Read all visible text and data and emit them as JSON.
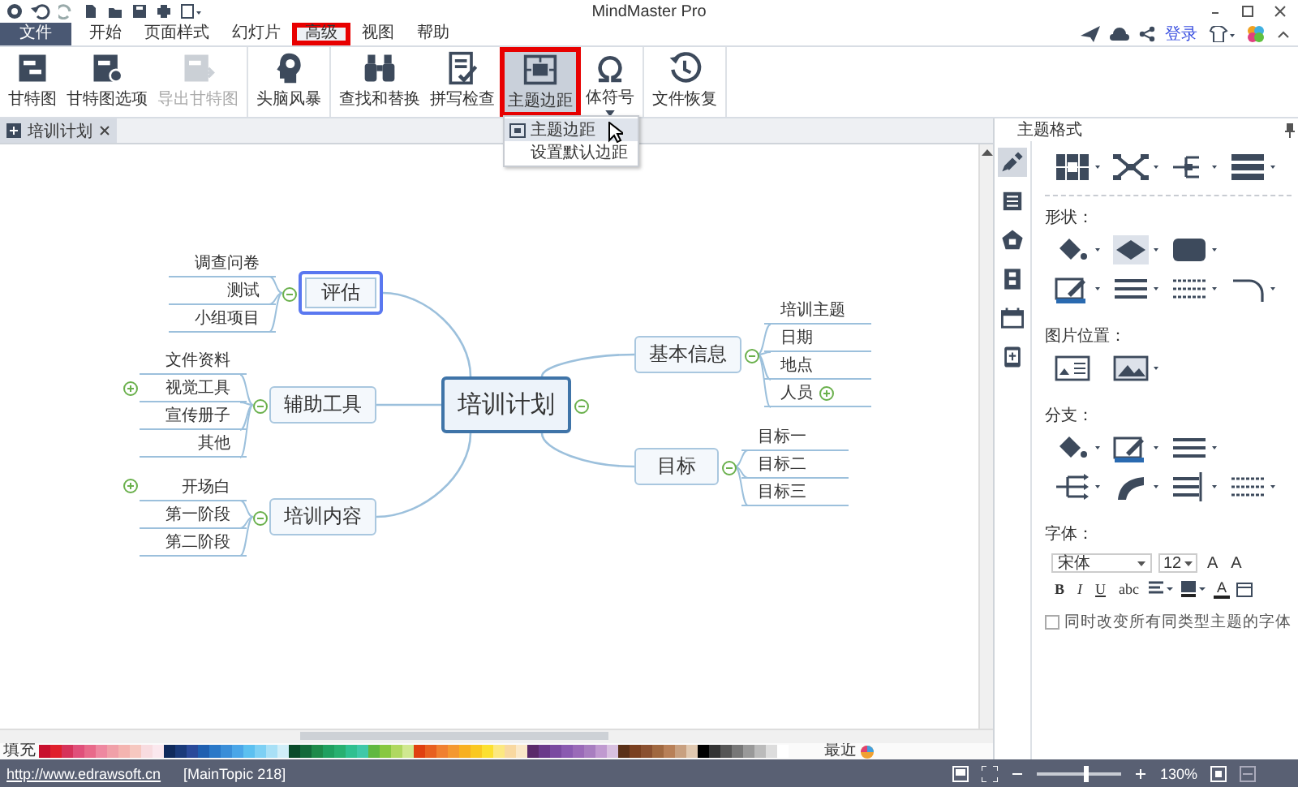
{
  "window": {
    "title": "MindMaster Pro"
  },
  "menu_tabs": [
    {
      "label": "文件",
      "kind": "file",
      "selected": false,
      "highlighted": false
    },
    {
      "label": "开始",
      "kind": "tab",
      "selected": false,
      "highlighted": false
    },
    {
      "label": "页面样式",
      "kind": "tab",
      "selected": false,
      "highlighted": false
    },
    {
      "label": "幻灯片",
      "kind": "tab",
      "selected": false,
      "highlighted": false
    },
    {
      "label": "高级",
      "kind": "tab",
      "selected": true,
      "highlighted": true
    },
    {
      "label": "视图",
      "kind": "tab",
      "selected": false,
      "highlighted": false
    },
    {
      "label": "帮助",
      "kind": "tab",
      "selected": false,
      "highlighted": false
    }
  ],
  "login": "登录",
  "ribbon": {
    "groups": [
      [
        {
          "label": "甘特图",
          "disabled": false,
          "highlighted": false,
          "dropdown": false
        },
        {
          "label": "甘特图选项",
          "disabled": false,
          "highlighted": false,
          "dropdown": false
        },
        {
          "label": "导出甘特图",
          "disabled": true,
          "highlighted": false,
          "dropdown": false
        }
      ],
      [
        {
          "label": "头脑风暴",
          "disabled": false,
          "highlighted": false,
          "dropdown": false
        }
      ],
      [
        {
          "label": "查找和替换",
          "disabled": false,
          "highlighted": false,
          "dropdown": false
        },
        {
          "label": "拼写检查",
          "disabled": false,
          "highlighted": false,
          "dropdown": false
        },
        {
          "label": "主题边距",
          "disabled": false,
          "highlighted": true,
          "dropdown": false
        },
        {
          "label": "体符号",
          "disabled": false,
          "highlighted": false,
          "dropdown": true
        }
      ],
      [
        {
          "label": "文件恢复",
          "disabled": false,
          "highlighted": false,
          "dropdown": false
        }
      ]
    ]
  },
  "dropdown_menu": [
    {
      "label": "主题边距",
      "hovered": true
    },
    {
      "label": "设置默认边距",
      "hovered": false
    }
  ],
  "document_tabs": [
    {
      "label": "培训计划",
      "selected": true
    }
  ],
  "mind_map": {
    "topic": {
      "text": "培训计划",
      "collapsed": false
    },
    "branches": [
      {
        "text": "评估",
        "selected": true,
        "collapsed": false,
        "children": [
          {
            "text": "调查问卷",
            "collapsed": false
          },
          {
            "text": "测试",
            "collapsed": false
          },
          {
            "text": "小组项目",
            "collapsed": false
          }
        ]
      },
      {
        "text": "辅助工具",
        "selected": false,
        "collapsed": false,
        "children": [
          {
            "text": "文件资料",
            "collapsed": false
          },
          {
            "text": "视觉工具",
            "collapsed": true
          },
          {
            "text": "宣传册子",
            "collapsed": false
          },
          {
            "text": "其他",
            "collapsed": false
          }
        ]
      },
      {
        "text": "培训内容",
        "selected": false,
        "collapsed": false,
        "children": [
          {
            "text": "开场白",
            "collapsed": true
          },
          {
            "text": "第一阶段",
            "collapsed": false
          },
          {
            "text": "第二阶段",
            "collapsed": false
          }
        ]
      },
      {
        "text": "基本信息",
        "selected": false,
        "collapsed": false,
        "children": [
          {
            "text": "培训主题",
            "collapsed": false
          },
          {
            "text": "日期",
            "collapsed": false
          },
          {
            "text": "地点",
            "collapsed": false
          },
          {
            "text": "人员",
            "collapsed": true
          }
        ]
      },
      {
        "text": "目标",
        "selected": false,
        "collapsed": false,
        "children": [
          {
            "text": "目标一",
            "collapsed": false
          },
          {
            "text": "目标二",
            "collapsed": false
          },
          {
            "text": "目标三",
            "collapsed": false
          }
        ]
      }
    ]
  },
  "format_panel": {
    "title": "主题格式",
    "side_tabs": [
      {
        "selected": true
      },
      {
        "selected": false
      },
      {
        "selected": false
      },
      {
        "selected": false
      },
      {
        "selected": false
      },
      {
        "selected": false
      }
    ],
    "shape_heading": "形状：",
    "image_heading": "图片位置：",
    "branch_heading": "分支：",
    "font_heading": "字体：",
    "font": {
      "family": "宋体",
      "size": "12",
      "size_buttons": [
        "A",
        "A"
      ],
      "style_buttons": [
        "B",
        "I",
        "U",
        "abc"
      ],
      "color_button": "A"
    },
    "same_type_checkbox": {
      "label": "同时改变所有同类型主题的字体",
      "checked": false
    }
  },
  "palette": {
    "label": "填充",
    "recent_label": "最近",
    "swatches": [
      {
        "color": "#c8102e"
      },
      {
        "color": "#e0202c"
      },
      {
        "color": "#d6335a"
      },
      {
        "color": "#e0507a"
      },
      {
        "color": "#e86a8a"
      },
      {
        "color": "#ee88a0"
      },
      {
        "color": "#f0a0a8"
      },
      {
        "color": "#f4b4b0"
      },
      {
        "color": "#f6c8c0"
      },
      {
        "color": "#f8dce0"
      },
      {
        "color": "#fbe8ee"
      },
      {
        "color": "#102a5c"
      },
      {
        "color": "#1a3a7a"
      },
      {
        "color": "#2a4a9a"
      },
      {
        "color": "#1f5fb0"
      },
      {
        "color": "#2a78c8"
      },
      {
        "color": "#3a8ed8"
      },
      {
        "color": "#4aa6e8"
      },
      {
        "color": "#5cc0f0"
      },
      {
        "color": "#7dd0f4"
      },
      {
        "color": "#a8e0f6"
      },
      {
        "color": "#d0eef8"
      },
      {
        "color": "#0a4a2a"
      },
      {
        "color": "#146a3a"
      },
      {
        "color": "#1e8a4a"
      },
      {
        "color": "#20a060"
      },
      {
        "color": "#28b070"
      },
      {
        "color": "#30c090"
      },
      {
        "color": "#40c8a8"
      },
      {
        "color": "#60b840"
      },
      {
        "color": "#88c840"
      },
      {
        "color": "#b0d860"
      },
      {
        "color": "#d0e890"
      },
      {
        "color": "#e04010"
      },
      {
        "color": "#e86020"
      },
      {
        "color": "#f08030"
      },
      {
        "color": "#f49830"
      },
      {
        "color": "#f8b020"
      },
      {
        "color": "#fac820"
      },
      {
        "color": "#fce030"
      },
      {
        "color": "#fce880"
      },
      {
        "color": "#f8d8a0"
      },
      {
        "color": "#fae8c8"
      },
      {
        "color": "#5a2a6a"
      },
      {
        "color": "#6a3a8a"
      },
      {
        "color": "#7a4aa0"
      },
      {
        "color": "#8a5ab0"
      },
      {
        "color": "#9a6ab8"
      },
      {
        "color": "#a87ec0"
      },
      {
        "color": "#c09ad0"
      },
      {
        "color": "#d8c0e0"
      },
      {
        "color": "#5a3018"
      },
      {
        "color": "#7a4020"
      },
      {
        "color": "#8a5030"
      },
      {
        "color": "#a06840"
      },
      {
        "color": "#b88058"
      },
      {
        "color": "#c8a080"
      },
      {
        "color": "#e0c8b0"
      },
      {
        "color": "#000000"
      },
      {
        "color": "#333333"
      },
      {
        "color": "#555555"
      },
      {
        "color": "#777777"
      },
      {
        "color": "#999999"
      },
      {
        "color": "#bbbbbb"
      },
      {
        "color": "#dddddd"
      },
      {
        "color": "#ffffff"
      }
    ]
  },
  "status_bar": {
    "link": "http://www.edrawsoft.cn",
    "selection": "[MainTopic 218]",
    "zoom": {
      "level": 0.58,
      "reading": "130%"
    }
  }
}
